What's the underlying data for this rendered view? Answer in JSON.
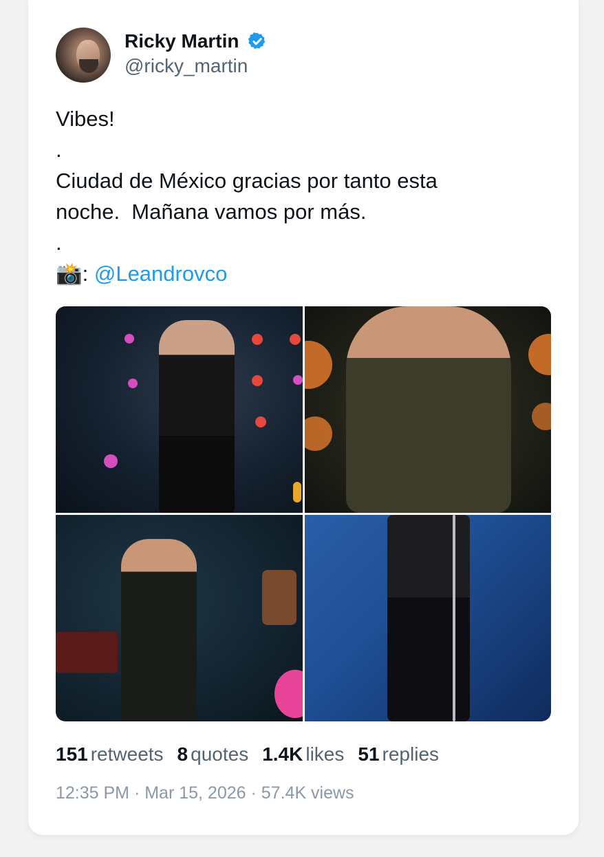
{
  "author": {
    "name": "Ricky Martin",
    "handle": "@ricky_martin",
    "verified": true,
    "avatar_icon": "profile-photo"
  },
  "tweet": {
    "lines": [
      "Vibes!",
      ".",
      "Ciudad de México gracias por tanto esta",
      "noche.  Mañana vamos por más.",
      "."
    ],
    "camera_emoji": "📸",
    "camera_suffix": ":",
    "mention": "@Leandrovco"
  },
  "stats": {
    "retweets": {
      "value": "151",
      "label": "retweets"
    },
    "quotes": {
      "value": "8",
      "label": "quotes"
    },
    "likes": {
      "value": "1.4K",
      "label": "likes"
    },
    "replies": {
      "value": "51",
      "label": "replies"
    }
  },
  "meta": {
    "time": "12:35 PM",
    "separator": " · ",
    "date": "Mar 15, 2026",
    "views": "57.4K views"
  },
  "colors": {
    "accent": "#1d9bf0",
    "text": "#0f1419",
    "muted": "#536471",
    "verified": "#1d9bf0"
  }
}
